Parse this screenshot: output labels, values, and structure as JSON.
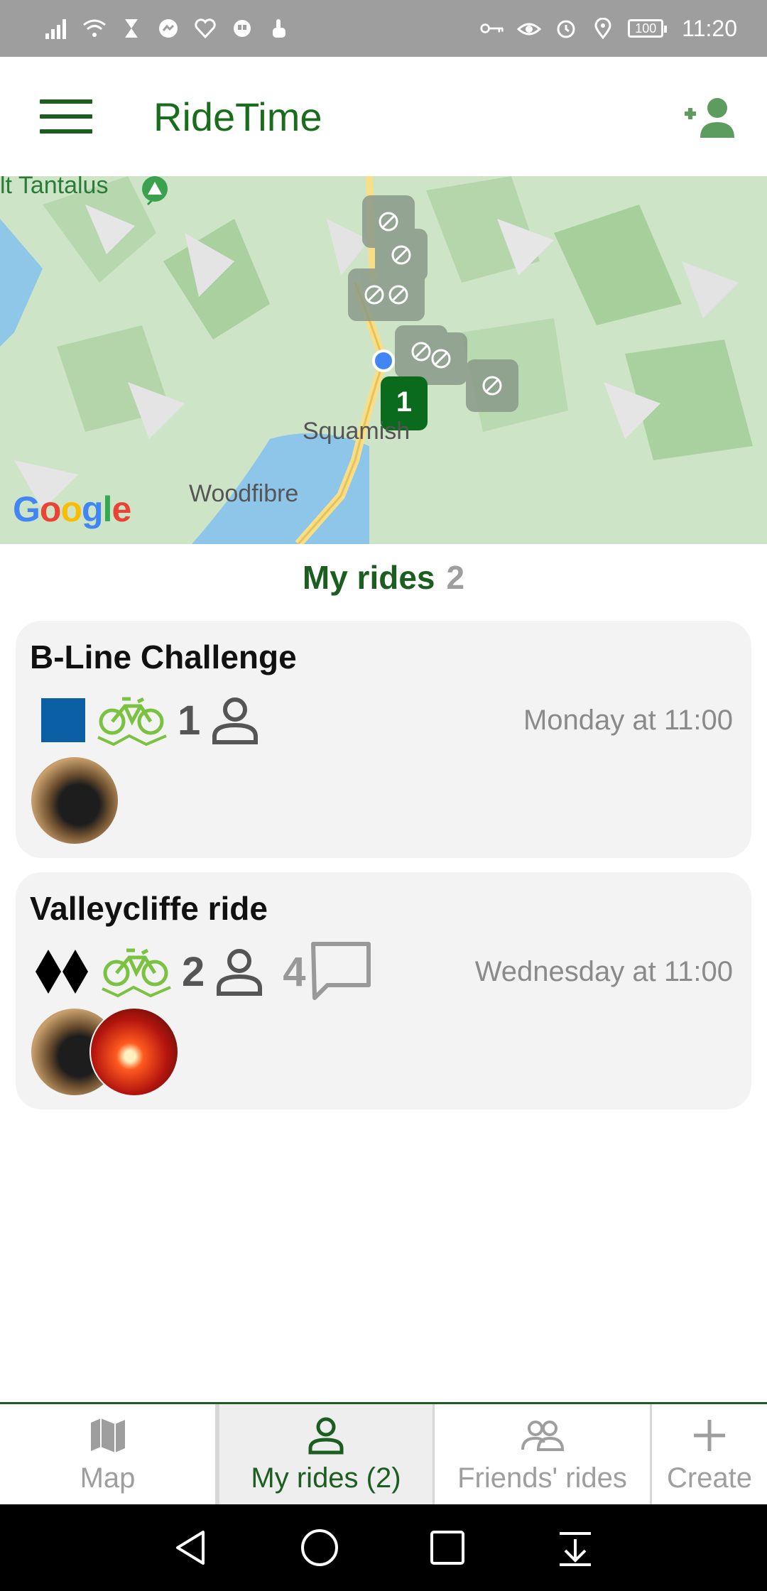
{
  "status_bar": {
    "time": "11:20",
    "battery": "100"
  },
  "app_bar": {
    "title": "RideTime"
  },
  "map": {
    "labels": {
      "tantalus": "lt Tantalus",
      "squamish": "Squamish",
      "woodfibre": "Woodfibre"
    },
    "google_logo": [
      "G",
      "o",
      "o",
      "g",
      "l",
      "e"
    ],
    "cluster_count": "1"
  },
  "section": {
    "title": "My rides",
    "count": "2"
  },
  "rides": [
    {
      "title": "B-Line Challenge",
      "difficulty": "blue-square",
      "riders": "1",
      "messages": "",
      "time": "Monday at 11:00",
      "avatars": [
        "cat"
      ]
    },
    {
      "title": "Valleycliffe ride",
      "difficulty": "double-black-diamond",
      "riders": "2",
      "messages": "4",
      "time": "Wednesday at 11:00",
      "avatars": [
        "cat",
        "fire"
      ]
    }
  ],
  "tabs": [
    {
      "label": "Map",
      "icon": "map-icon"
    },
    {
      "label": "My rides (2)",
      "icon": "person-icon"
    },
    {
      "label": "Friends' rides",
      "icon": "people-icon"
    },
    {
      "label": "Create",
      "icon": "plus-icon"
    }
  ],
  "colors": {
    "brand": "#1b5e20",
    "accent_green": "#7cc242",
    "blue_square": "#0b5fa5",
    "tab_inactive": "#9e9e9e"
  }
}
